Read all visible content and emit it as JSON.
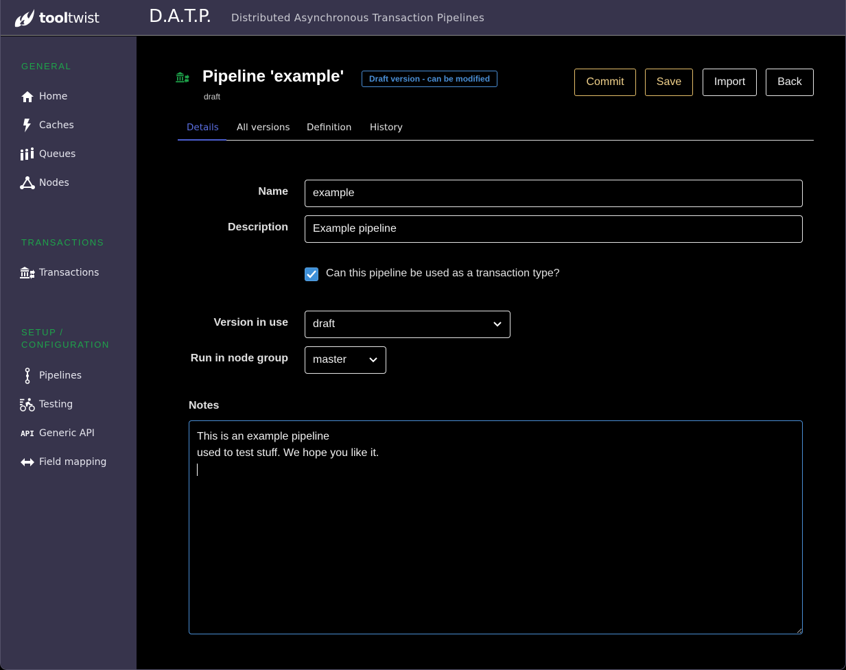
{
  "header": {
    "brand_bold": "tool",
    "brand_light": "twist",
    "app_title": "D.A.T.P.",
    "app_subtitle": "Distributed Asynchronous Transaction Pipelines"
  },
  "sidebar": {
    "sections": [
      {
        "title": "GENERAL",
        "items": [
          {
            "label": "Home",
            "icon": "home-icon"
          },
          {
            "label": "Caches",
            "icon": "bolt-icon"
          },
          {
            "label": "Queues",
            "icon": "people-queue-icon"
          },
          {
            "label": "Nodes",
            "icon": "nodes-icon"
          }
        ]
      },
      {
        "title": "TRANSACTIONS",
        "items": [
          {
            "label": "Transactions",
            "icon": "bank-transfer-icon"
          }
        ]
      },
      {
        "title_line1": "SETUP /",
        "title_line2": "CONFIGURATION",
        "items": [
          {
            "label": "Pipelines",
            "icon": "pipeline-icon"
          },
          {
            "label": "Testing",
            "icon": "cyclist-icon"
          },
          {
            "label": "Generic API",
            "icon": "api-icon"
          },
          {
            "label": "Field mapping",
            "icon": "arrows-horizontal-icon"
          }
        ]
      }
    ]
  },
  "page": {
    "icon": "bank-transfer-icon",
    "title": "Pipeline 'example'",
    "subtitle": "draft",
    "badge": "Draft version - can be modified",
    "colors": {
      "accent_green": "#1ea34a",
      "badge_blue": "#4a8fd6",
      "warn_gold": "#e6bf6a",
      "tab_active": "#5a6ee0"
    },
    "buttons": {
      "commit": "Commit",
      "save": "Save",
      "import": "Import",
      "back": "Back"
    },
    "tabs": [
      {
        "label": "Details",
        "active": true
      },
      {
        "label": "All versions",
        "active": false
      },
      {
        "label": "Definition",
        "active": false
      },
      {
        "label": "History",
        "active": false
      }
    ]
  },
  "form": {
    "name_label": "Name",
    "name_value": "example",
    "description_label": "Description",
    "description_value": "Example pipeline",
    "transaction_type_label": "Can this pipeline be used as a transaction type?",
    "transaction_type_checked": true,
    "version_label": "Version in use",
    "version_value": "draft",
    "node_group_label": "Run in node group",
    "node_group_value": "master",
    "notes_label": "Notes",
    "notes_value": "This is an example pipeline\nused to test stuff. We hope you like it.\n"
  }
}
